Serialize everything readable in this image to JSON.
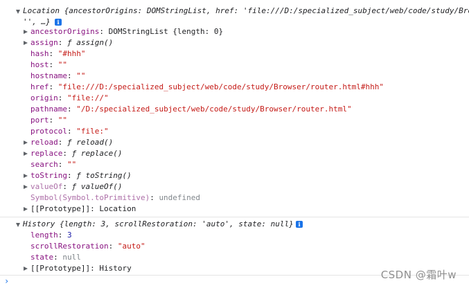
{
  "location": {
    "summary_label": "Location",
    "summary_body": "{ancestorOrigins: DOMStringList, href: 'file:///D:/specialized_subject/web/code/study/Bro",
    "summary_cont": "'', …}",
    "info_glyph": "i",
    "props": [
      {
        "key": "ancestorOrigins",
        "sep": ": ",
        "value": "DOMStringList {length: 0}"
      },
      {
        "key": "assign",
        "sep": ": ",
        "value": "ƒ assign()"
      },
      {
        "key": "hash",
        "sep": ": ",
        "value": "\"#hhh\""
      },
      {
        "key": "host",
        "sep": ": ",
        "value": "\"\""
      },
      {
        "key": "hostname",
        "sep": ": ",
        "value": "\"\""
      },
      {
        "key": "href",
        "sep": ": ",
        "value": "\"file:///D:/specialized_subject/web/code/study/Browser/router.html#hhh\""
      },
      {
        "key": "origin",
        "sep": ": ",
        "value": "\"file://\""
      },
      {
        "key": "pathname",
        "sep": ": ",
        "value": "\"/D:/specialized_subject/web/code/study/Browser/router.html\""
      },
      {
        "key": "port",
        "sep": ": ",
        "value": "\"\""
      },
      {
        "key": "protocol",
        "sep": ": ",
        "value": "\"file:\""
      },
      {
        "key": "reload",
        "sep": ": ",
        "value": "ƒ reload()"
      },
      {
        "key": "replace",
        "sep": ": ",
        "value": "ƒ replace()"
      },
      {
        "key": "search",
        "sep": ": ",
        "value": "\"\""
      },
      {
        "key": "toString",
        "sep": ": ",
        "value": "ƒ toString()"
      },
      {
        "key": "valueOf",
        "sep": ": ",
        "value": "ƒ valueOf()"
      },
      {
        "key": "Symbol(Symbol.toPrimitive)",
        "sep": ": ",
        "value": "undefined"
      },
      {
        "key": "[[Prototype]]",
        "sep": ": ",
        "value": "Location"
      }
    ]
  },
  "history": {
    "summary_label": "History",
    "summary_body": "{length: 3, scrollRestoration: 'auto', state: null}",
    "info_glyph": "i",
    "props": [
      {
        "key": "length",
        "sep": ": ",
        "value": "3"
      },
      {
        "key": "scrollRestoration",
        "sep": ": ",
        "value": "\"auto\""
      },
      {
        "key": "state",
        "sep": ": ",
        "value": "null"
      },
      {
        "key": "[[Prototype]]",
        "sep": ": ",
        "value": "History"
      }
    ]
  },
  "prompt_symbol": "›",
  "watermark": "CSDN @霜叶w"
}
